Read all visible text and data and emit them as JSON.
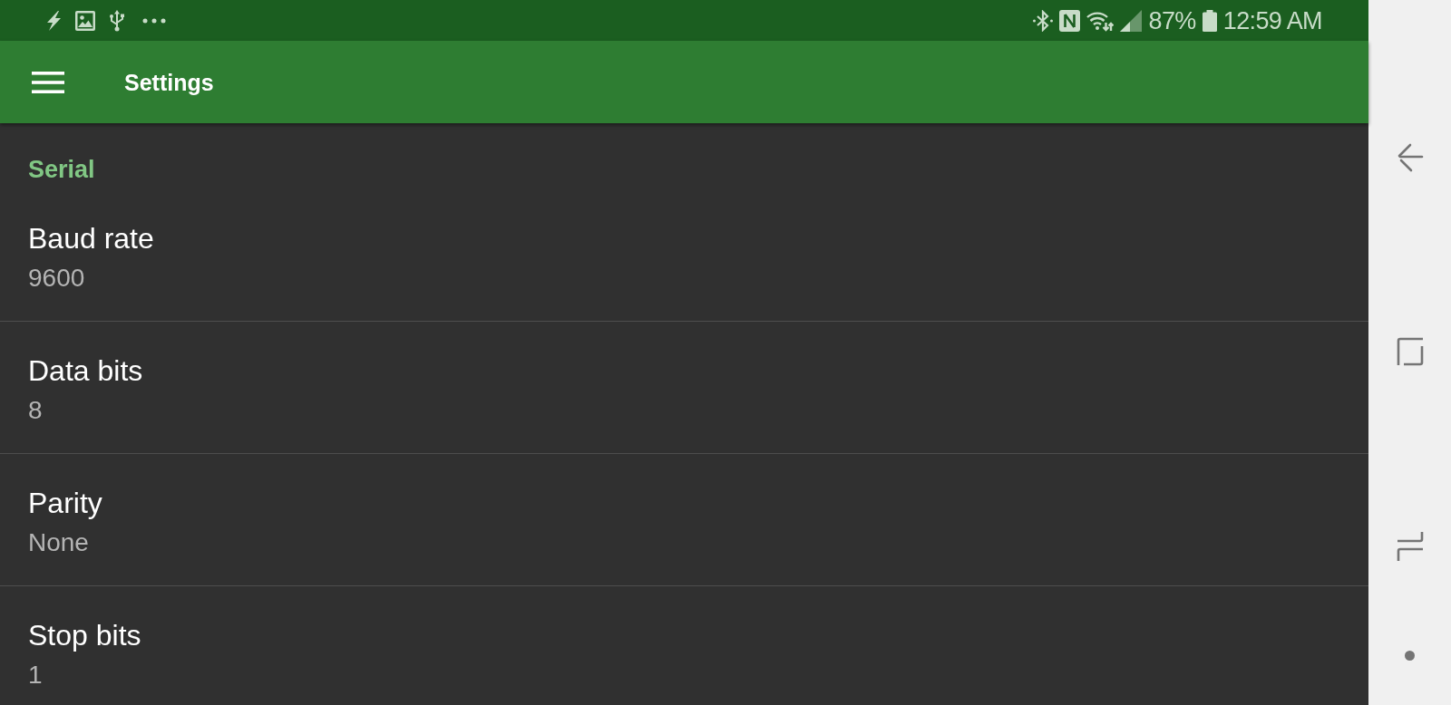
{
  "status_bar": {
    "battery_percent": "87%",
    "time": "12:59 AM"
  },
  "app_bar": {
    "title": "Settings"
  },
  "settings": {
    "category": "Serial",
    "items": [
      {
        "title": "Baud rate",
        "summary": "9600"
      },
      {
        "title": "Data bits",
        "summary": "8"
      },
      {
        "title": "Parity",
        "summary": "None"
      },
      {
        "title": "Stop bits",
        "summary": "1"
      }
    ]
  }
}
